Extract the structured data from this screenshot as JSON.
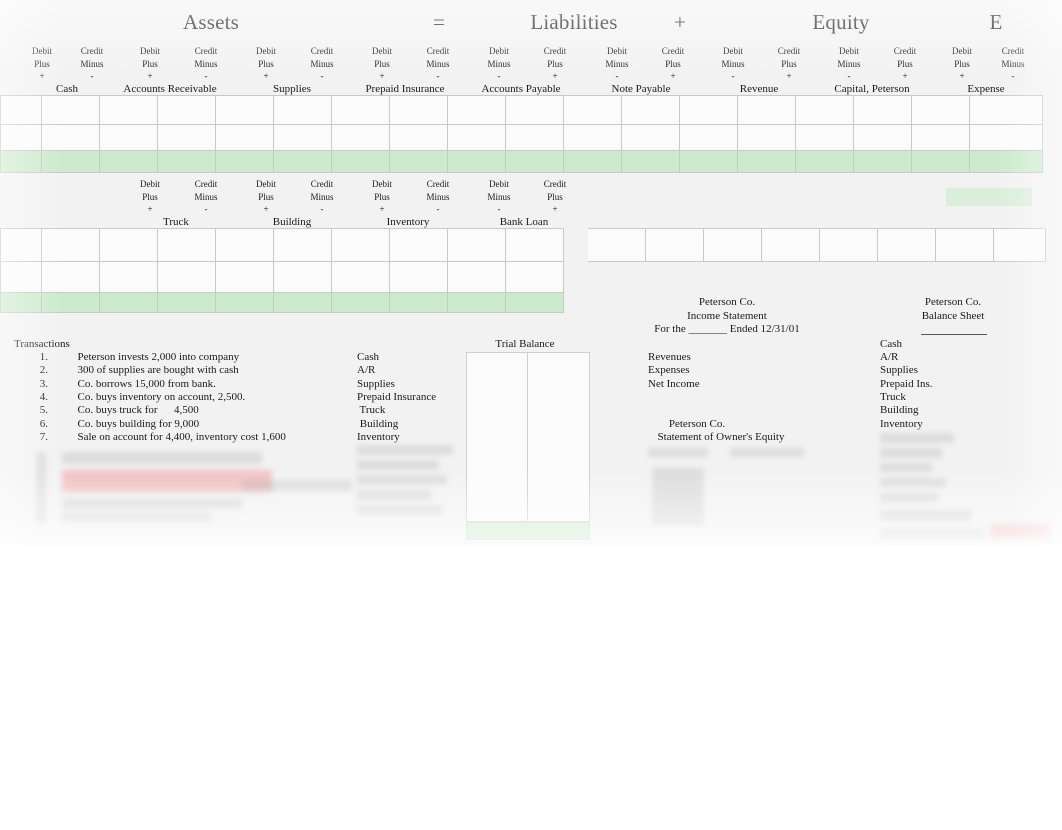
{
  "equation": {
    "assets_label": "Assets",
    "equals_label": "=",
    "liabilities_label": "Liabilities",
    "plus_label": "+",
    "equity_label": "Equity",
    "expense_initial_label": "E"
  },
  "column_header_terms": {
    "debit": "Debit",
    "credit": "Credit",
    "plus_word": "Plus",
    "minus_word": "Minus",
    "plus_sign": "+",
    "minus_sign": "-"
  },
  "accounts_row1": [
    {
      "name": "Cash",
      "left_type": "Debit",
      "left_word": "Plus",
      "left_sign": "+",
      "right_type": "Credit",
      "right_word": "Minus",
      "right_sign": "-"
    },
    {
      "name": "Accounts Receivable",
      "left_type": "Debit",
      "left_word": "Plus",
      "left_sign": "+",
      "right_type": "Credit",
      "right_word": "Minus",
      "right_sign": "-"
    },
    {
      "name": "Supplies",
      "left_type": "Debit",
      "left_word": "Plus",
      "left_sign": "+",
      "right_type": "Credit",
      "right_word": "Minus",
      "right_sign": "-"
    },
    {
      "name": "Prepaid Insurance",
      "left_type": "Debit",
      "left_word": "Plus",
      "left_sign": "+",
      "right_type": "Credit",
      "right_word": "Minus",
      "right_sign": "-"
    },
    {
      "name": "Accounts Payable",
      "left_type": "Debit",
      "left_word": "Minus",
      "left_sign": "-",
      "right_type": "Credit",
      "right_word": "Plus",
      "right_sign": "+"
    },
    {
      "name": "Note Payable",
      "left_type": "Debit",
      "left_word": "Minus",
      "left_sign": "-",
      "right_type": "Credit",
      "right_word": "Plus",
      "right_sign": "+"
    },
    {
      "name": "Revenue",
      "left_type": "Debit",
      "left_word": "Minus",
      "left_sign": "-",
      "right_type": "Credit",
      "right_word": "Plus",
      "right_sign": "+"
    },
    {
      "name": "Capital, Peterson",
      "left_type": "Debit",
      "left_word": "Minus",
      "left_sign": "-",
      "right_type": "Credit",
      "right_word": "Plus",
      "right_sign": "+"
    },
    {
      "name": "Expense",
      "left_type": "Debit",
      "left_word": "Plus",
      "left_sign": "+",
      "right_type": "Credit",
      "right_word": "Minus",
      "right_sign": "-"
    }
  ],
  "accounts_row2": [
    {
      "name": "Truck",
      "left_type": "Debit",
      "left_word": "Plus",
      "left_sign": "+",
      "right_type": "Credit",
      "right_word": "Minus",
      "right_sign": "-"
    },
    {
      "name": "Building",
      "left_type": "Debit",
      "left_word": "Plus",
      "left_sign": "+",
      "right_type": "Credit",
      "right_word": "Minus",
      "right_sign": "-"
    },
    {
      "name": "Inventory",
      "left_type": "Debit",
      "left_word": "Plus",
      "left_sign": "+",
      "right_type": "Credit",
      "right_word": "Minus",
      "right_sign": "-"
    },
    {
      "name": "Bank Loan",
      "left_type": "Debit",
      "left_word": "Minus",
      "left_sign": "-",
      "right_type": "Credit",
      "right_word": "Plus",
      "right_sign": "+"
    }
  ],
  "transactions": {
    "title": "Transactions",
    "items": [
      {
        "num": "1.",
        "text": "Peterson invests 2,000 into company"
      },
      {
        "num": "2.",
        "text": "300 of supplies are bought with cash"
      },
      {
        "num": "3.",
        "text": "Co. borrows 15,000 from bank."
      },
      {
        "num": "4.",
        "text": "Co. buys inventory on account, 2,500."
      },
      {
        "num": "5.",
        "text": "Co. buys truck for      4,500"
      },
      {
        "num": "6.",
        "text": "Co. buys building for 9,000"
      },
      {
        "num": "7.",
        "text": "Sale on account for 4,400, inventory cost 1,600"
      }
    ]
  },
  "trial_balance": {
    "title": "Trial Balance",
    "accounts": [
      "Cash",
      "A/R",
      "Supplies",
      "Prepaid Insurance",
      " Truck",
      " Building",
      "Inventory"
    ]
  },
  "income_statement": {
    "company": "Peterson Co.",
    "title": "Income Statement",
    "period": "For the _______ Ended 12/31/01",
    "lines": [
      "Revenues",
      "Expenses",
      "Net Income"
    ]
  },
  "owners_equity": {
    "company": "Peterson Co.",
    "title": "Statement of Owner's Equity"
  },
  "balance_sheet": {
    "company": "Peterson Co.",
    "title": "Balance Sheet",
    "date_blank": "",
    "lines": [
      "Cash",
      "A/R",
      "Supplies",
      "Prepaid Ins.",
      "Truck",
      "Building",
      "Inventory"
    ]
  },
  "colors": {
    "total_row_green": "#ccebcc",
    "page_background": "#f2f2f2",
    "grid_line": "#c8c8c8",
    "text": "#1a1a1a"
  }
}
